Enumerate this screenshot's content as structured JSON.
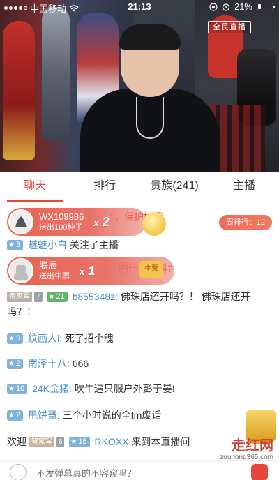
{
  "status_bar": {
    "carrier": "中国移动",
    "time": "21:13",
    "battery_text": "21%",
    "battery_level": 0.21
  },
  "video": {
    "logo_text": "全民直播"
  },
  "tabs": [
    {
      "label": "聊天",
      "active": true
    },
    {
      "label": "排行",
      "active": false
    },
    {
      "label": "贵族(241)",
      "active": false
    },
    {
      "label": "主播",
      "active": false
    }
  ],
  "rank_pill": "周排行：12",
  "gifts": [
    {
      "name": "WX109986",
      "desc": "送出100种子",
      "count": "2",
      "behind_text": "了，保护好我"
    },
    {
      "name": "朕辰",
      "desc": "送出牛票",
      "count": "1",
      "behind_text": "的什么饮料?",
      "tag": "牛票"
    }
  ],
  "messages": [
    {
      "level": "3",
      "user": "魅魅小白",
      "text": "关注了主播"
    },
    {
      "level": "21",
      "badge": "帝家军",
      "badge_num": "7",
      "user": "b855348z:",
      "text": "佛珠店还开吗？！ 佛珠店还开吗？！"
    },
    {
      "level": "9",
      "user": "纹画人i:",
      "text": "死了招个魂"
    },
    {
      "level": "2",
      "user": "南泽十八:",
      "text": "666"
    },
    {
      "level": "10",
      "user": "24K金猪:",
      "text": "吹牛逼只服户外彭于晏!"
    },
    {
      "level": "2",
      "user": "甩饼哥:",
      "text": "三个小时说的全tm废话"
    }
  ],
  "welcome": {
    "prefix": "欢迎",
    "badge": "智家军",
    "badge_num": "6",
    "level": "15",
    "user": "RKOXX",
    "suffix": "来到本直播间"
  },
  "input": {
    "placeholder": "不发弹幕真的不容窥吗？"
  },
  "watermark": {
    "text": "走红网",
    "url": "zouhong365.com"
  },
  "colors": {
    "accent": "#e5473b",
    "username": "#4a90c8",
    "level_badge": "#7fb3dd",
    "gift_banner": "#e8634f"
  }
}
